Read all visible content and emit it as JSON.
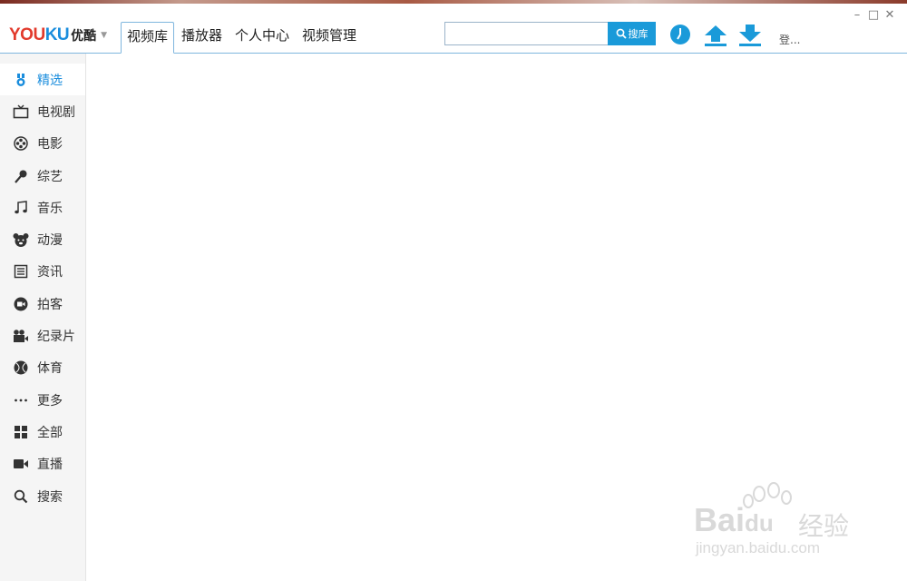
{
  "app": {
    "logo_text_a": "YOU",
    "logo_text_b": "KU",
    "logo_cn": "优酷",
    "brand_red": "#e23a2c",
    "brand_blue": "#1a8ddd"
  },
  "nav": {
    "tabs": [
      {
        "label": "视频库",
        "active": true
      },
      {
        "label": "播放器",
        "active": false
      },
      {
        "label": "个人中心",
        "active": false
      },
      {
        "label": "视频管理",
        "active": false
      }
    ]
  },
  "search": {
    "value": "",
    "placeholder": "",
    "button_label": "搜库"
  },
  "toolbar": {
    "history_icon": "clock-icon",
    "upload_icon": "upload-arrow-icon",
    "download_icon": "download-arrow-icon",
    "login_label": "登..."
  },
  "window_controls": {
    "minimize": "–",
    "maximize": "□",
    "close": "✕"
  },
  "sidebar": {
    "items": [
      {
        "label": "精选",
        "icon": "medal-icon",
        "active": true
      },
      {
        "label": "电视剧",
        "icon": "tv-icon",
        "active": false
      },
      {
        "label": "电影",
        "icon": "film-reel-icon",
        "active": false
      },
      {
        "label": "综艺",
        "icon": "microphone-icon",
        "active": false
      },
      {
        "label": "音乐",
        "icon": "music-note-icon",
        "active": false
      },
      {
        "label": "动漫",
        "icon": "bear-face-icon",
        "active": false
      },
      {
        "label": "资讯",
        "icon": "newspaper-icon",
        "active": false
      },
      {
        "label": "拍客",
        "icon": "camera-circle-icon",
        "active": false
      },
      {
        "label": "纪录片",
        "icon": "movie-camera-icon",
        "active": false
      },
      {
        "label": "体育",
        "icon": "ball-icon",
        "active": false
      },
      {
        "label": "更多",
        "icon": "more-dots-icon",
        "active": false
      },
      {
        "label": "全部",
        "icon": "grid-icon",
        "active": false
      },
      {
        "label": "直播",
        "icon": "video-camera-icon",
        "active": false
      },
      {
        "label": "搜索",
        "icon": "search-icon",
        "active": false
      }
    ]
  },
  "watermark": {
    "brand": "Bai",
    "brand2": "du",
    "cn": "经验",
    "url": "jingyan.baidu.com"
  }
}
